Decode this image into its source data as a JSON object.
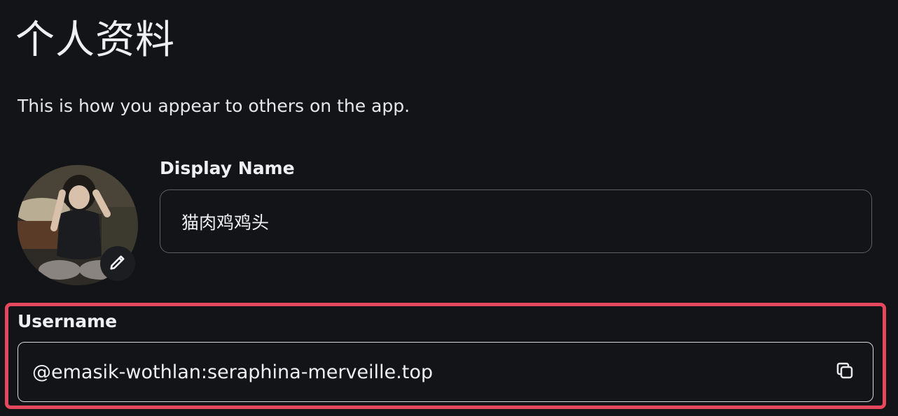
{
  "page": {
    "title": "个人资料",
    "subtitle": "This is how you appear to others on the app."
  },
  "avatar": {
    "edit_icon": "pencil-icon"
  },
  "display_name": {
    "label": "Display Name",
    "value": "猫肉鸡鸡头"
  },
  "username": {
    "label": "Username",
    "value": "@emasik-wothlan:seraphina-merveille.top",
    "copy_icon": "copy-icon"
  },
  "colors": {
    "background": "#121417",
    "text": "#eeeff1",
    "highlight": "#e5485d",
    "input_border": "#5b5f66"
  }
}
